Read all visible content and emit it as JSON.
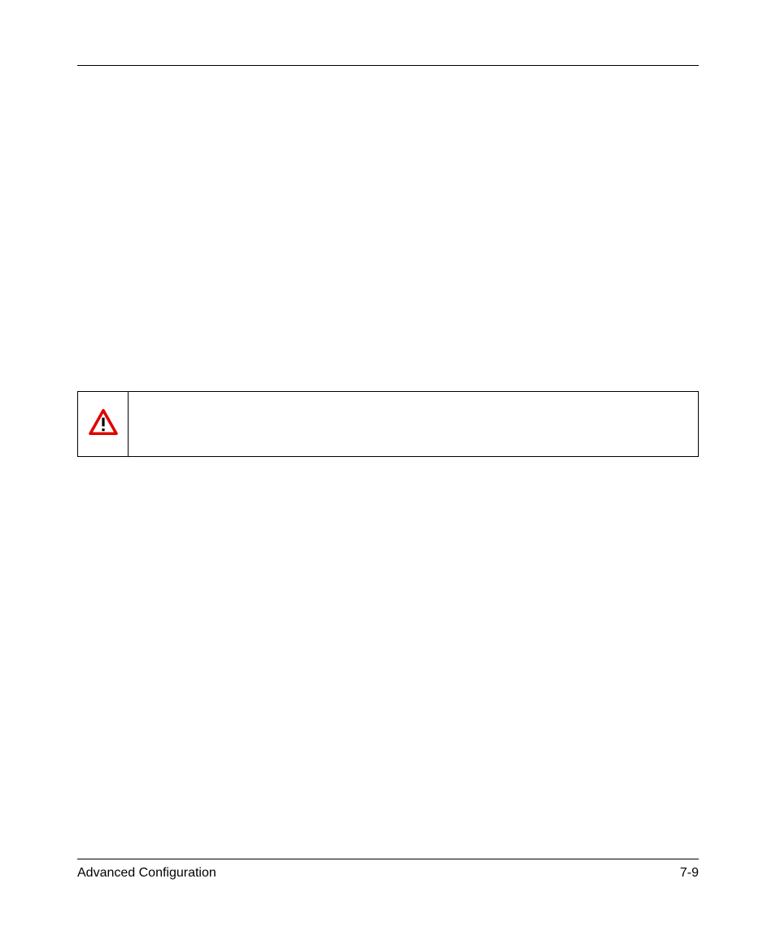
{
  "warning": {
    "text": ""
  },
  "footer": {
    "left": "Advanced Configuration",
    "right": "7-9"
  }
}
